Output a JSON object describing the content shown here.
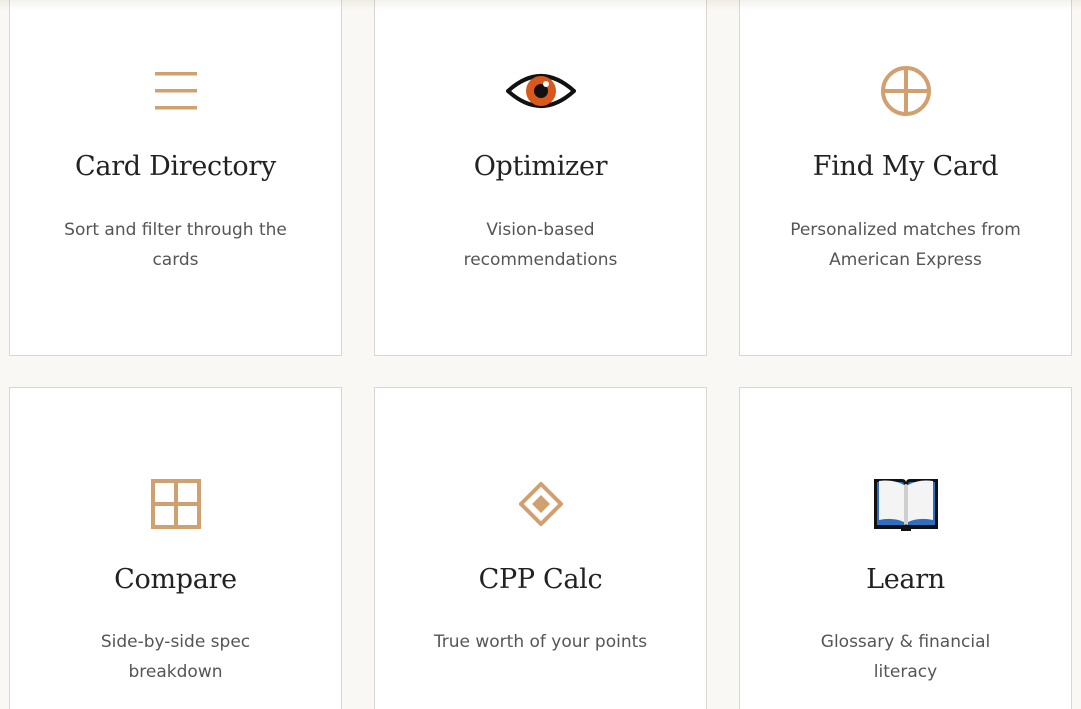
{
  "colors": {
    "accent": "#d1a06f",
    "background": "#faf8f4",
    "card_border": "#ddd6cc",
    "eye_iris": "#d9581c"
  },
  "tools": [
    {
      "title": "Card Directory",
      "description": "Sort and filter through the cards",
      "icon": "menu-icon"
    },
    {
      "title": "Optimizer",
      "description": "Vision-based recommendations",
      "icon": "eye-icon"
    },
    {
      "title": "Find My Card",
      "description": "Personalized matches from American Express",
      "icon": "crosshair-circle-icon"
    },
    {
      "title": "Compare",
      "description": "Side-by-side spec breakdown",
      "icon": "grid-icon"
    },
    {
      "title": "CPP Calc",
      "description": "True worth of your points",
      "icon": "diamond-icon"
    },
    {
      "title": "Learn",
      "description": "Glossary & financial literacy",
      "icon": "book-icon"
    }
  ]
}
